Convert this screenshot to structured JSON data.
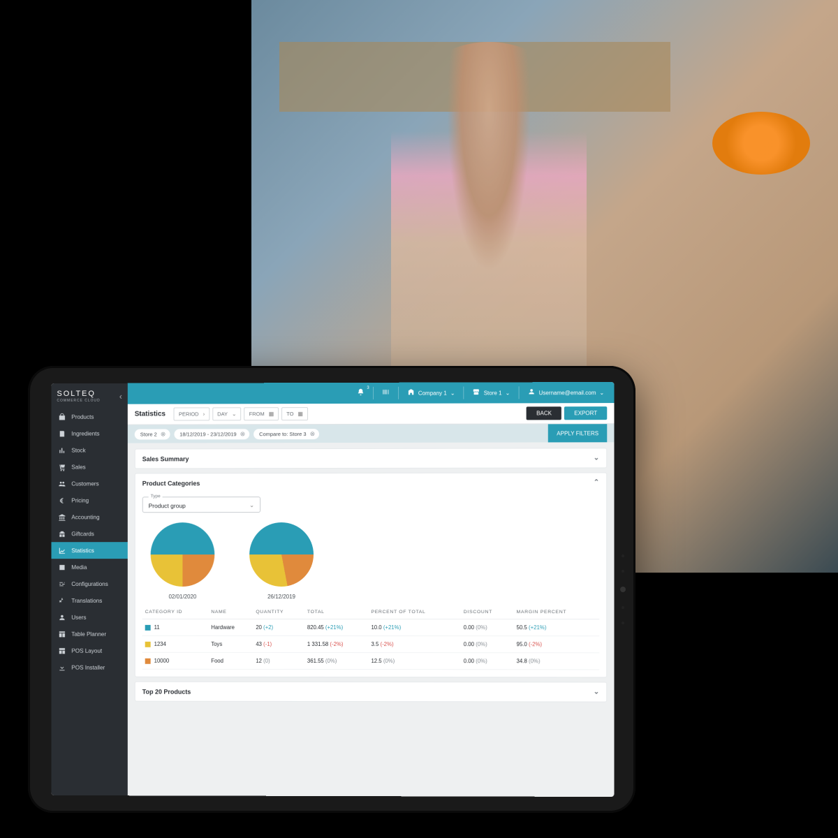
{
  "brand": {
    "name": "SOLTEQ",
    "sub": "COMMERCE CLOUD"
  },
  "sidebar": {
    "items": [
      {
        "label": "Products",
        "icon": "bag-icon"
      },
      {
        "label": "Ingredients",
        "icon": "recipe-icon"
      },
      {
        "label": "Stock",
        "icon": "bars-icon"
      },
      {
        "label": "Sales",
        "icon": "cart-icon"
      },
      {
        "label": "Customers",
        "icon": "people-icon"
      },
      {
        "label": "Pricing",
        "icon": "euro-icon"
      },
      {
        "label": "Accounting",
        "icon": "bank-icon"
      },
      {
        "label": "Giftcards",
        "icon": "gift-icon"
      },
      {
        "label": "Statistics",
        "icon": "chart-icon",
        "active": true
      },
      {
        "label": "Media",
        "icon": "media-icon"
      },
      {
        "label": "Configurations",
        "icon": "sliders-icon"
      },
      {
        "label": "Translations",
        "icon": "translate-icon"
      },
      {
        "label": "Users",
        "icon": "user-icon"
      },
      {
        "label": "Table Planner",
        "icon": "table-icon"
      },
      {
        "label": "POS Layout",
        "icon": "layout-icon"
      },
      {
        "label": "POS Installer",
        "icon": "download-icon"
      }
    ]
  },
  "topbar": {
    "notif_badge": "3",
    "company": "Company 1",
    "store": "Store 1",
    "user": "Username@email.com"
  },
  "filterbar": {
    "title": "Statistics",
    "period_label": "PERIOD",
    "day_label": "DAY",
    "from_label": "FROM",
    "to_label": "TO",
    "back": "BACK",
    "export": "EXPORT"
  },
  "chips": {
    "c1": "Store 2",
    "c2": "18/12/2019 - 23/12/2019",
    "c3": "Compare to: Store 3",
    "apply": "APPLY FILTERS"
  },
  "sections": {
    "sales_summary": "Sales Summary",
    "product_categories": "Product Categories",
    "top20": "Top 20 Products"
  },
  "type_field": {
    "label": "Type",
    "value": "Product group"
  },
  "pies": {
    "p1_label": "02/01/2020",
    "p2_label": "26/12/2019"
  },
  "table": {
    "headers": {
      "cat": "CATEGORY ID",
      "name": "NAME",
      "qty": "QUANTITY",
      "total": "TOTAL",
      "pct": "PERCENT OF TOTAL",
      "disc": "DISCOUNT",
      "margin": "MARGIN PERCENT"
    },
    "rows": [
      {
        "color": "#2a9db5",
        "cat": "11",
        "name": "Hardware",
        "qty": "20",
        "qty_d": "(+2)",
        "qty_dc": "pos",
        "total": "820.45",
        "total_d": "(+21%)",
        "total_dc": "pos",
        "pct": "10.0",
        "pct_d": "(+21%)",
        "pct_dc": "pos",
        "disc": "0.00",
        "disc_d": "(0%)",
        "disc_dc": "zero",
        "margin": "50.5",
        "margin_d": "(+21%)",
        "margin_dc": "pos"
      },
      {
        "color": "#e8c237",
        "cat": "1234",
        "name": "Toys",
        "qty": "43",
        "qty_d": "(-1)",
        "qty_dc": "neg",
        "total": "1 331.58",
        "total_d": "(-2%)",
        "total_dc": "neg",
        "pct": "3.5",
        "pct_d": "(-2%)",
        "pct_dc": "neg",
        "disc": "0.00",
        "disc_d": "(0%)",
        "disc_dc": "zero",
        "margin": "95.0",
        "margin_d": "(-2%)",
        "margin_dc": "neg"
      },
      {
        "color": "#e08a3c",
        "cat": "10000",
        "name": "Food",
        "qty": "12",
        "qty_d": "(0)",
        "qty_dc": "zero",
        "total": "361.55",
        "total_d": "(0%)",
        "total_dc": "zero",
        "pct": "12.5",
        "pct_d": "(0%)",
        "pct_dc": "zero",
        "disc": "0.00",
        "disc_d": "(0%)",
        "disc_dc": "zero",
        "margin": "34.8",
        "margin_d": "(0%)",
        "margin_dc": "zero"
      }
    ]
  },
  "chart_data": [
    {
      "type": "pie",
      "title": "02/01/2020",
      "series": [
        {
          "name": "Hardware",
          "value": 50,
          "color": "#2a9db5"
        },
        {
          "name": "Food",
          "value": 25,
          "color": "#e08a3c"
        },
        {
          "name": "Toys",
          "value": 25,
          "color": "#e8c237"
        }
      ]
    },
    {
      "type": "pie",
      "title": "26/12/2019",
      "series": [
        {
          "name": "Hardware",
          "value": 50,
          "color": "#2a9db5"
        },
        {
          "name": "Food",
          "value": 22,
          "color": "#e08a3c"
        },
        {
          "name": "Toys",
          "value": 28,
          "color": "#e8c237"
        }
      ]
    }
  ],
  "colors": {
    "teal": "#2a9db5",
    "yellow": "#e8c237",
    "orange": "#e08a3c"
  }
}
